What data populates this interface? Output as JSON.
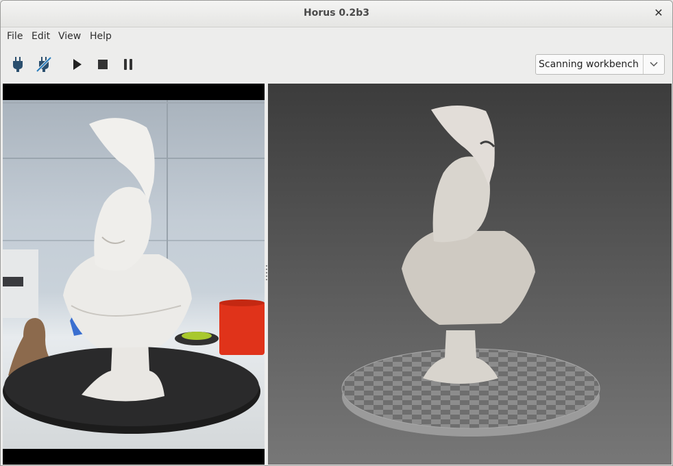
{
  "window": {
    "title": "Horus 0.2b3",
    "close_icon": "close-icon"
  },
  "menu": {
    "file": "File",
    "edit": "Edit",
    "view": "View",
    "help": "Help"
  },
  "toolbar": {
    "tools": [
      {
        "name": "connect-icon"
      },
      {
        "name": "disconnect-icon"
      },
      {
        "name": "play-icon"
      },
      {
        "name": "stop-icon"
      },
      {
        "name": "pause-icon"
      }
    ],
    "accent": "#2b4f6e",
    "workbench": {
      "selected": "Scanning workbench"
    }
  },
  "panels": {
    "camera": {
      "content": "webcam image of a white bust of a Greek warrior on a black turntable"
    },
    "viewer": {
      "content": "3D point cloud of the scanned bust on a checkered platform"
    }
  }
}
